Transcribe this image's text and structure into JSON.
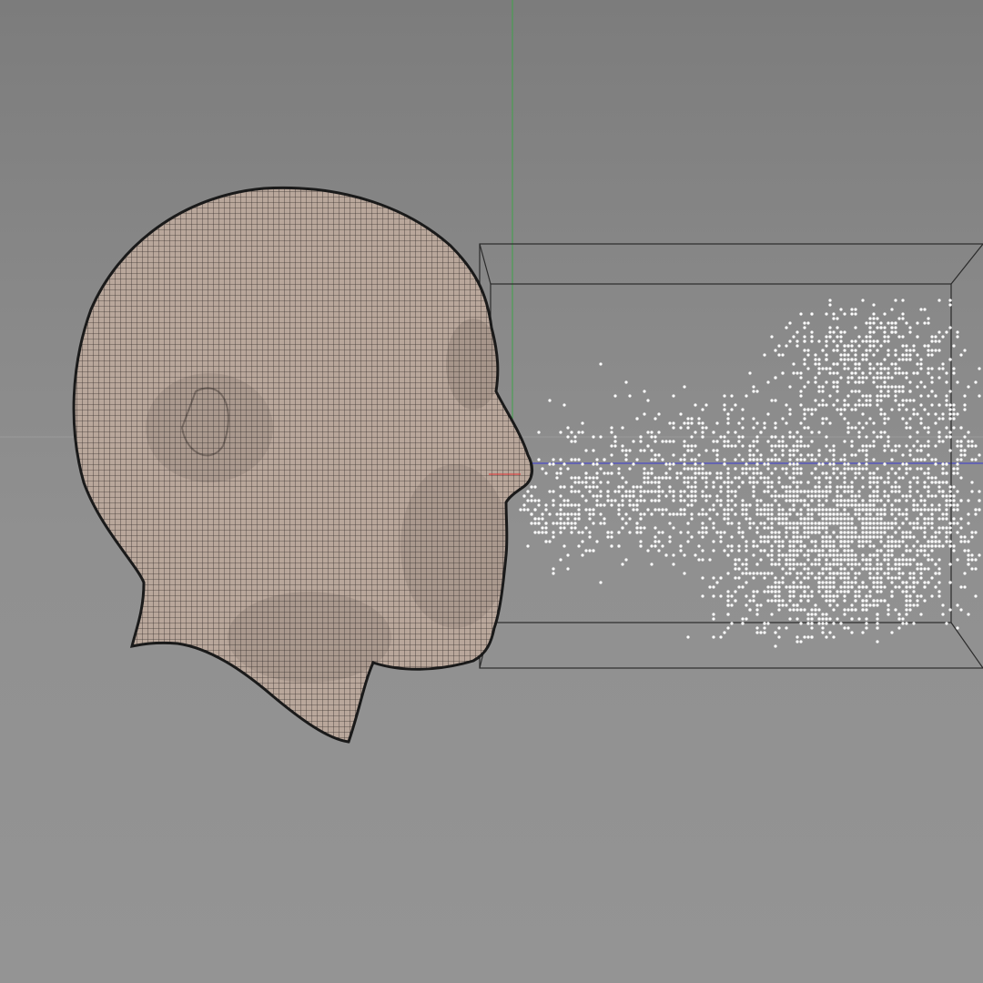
{
  "viewport": {
    "background_top": "#7c7c7c",
    "background_bottom": "#949494",
    "grid_line_color": "#9a9a9a"
  },
  "axes": {
    "y_axis_color": "#3fa34a",
    "z_axis_color": "#3b3bd6",
    "x_axis_color": "#e03030"
  },
  "head_mesh": {
    "object": "head-mesh",
    "skin_color": "#b9a79b",
    "wire_color": "#3a3330",
    "outline_color": "#1a1a1a"
  },
  "bounding_box": {
    "object": "particle-emitter-bounding-box",
    "line_color": "#2b2b2b"
  },
  "particles": {
    "object": "particle-cloud",
    "color": "#ffffff"
  }
}
